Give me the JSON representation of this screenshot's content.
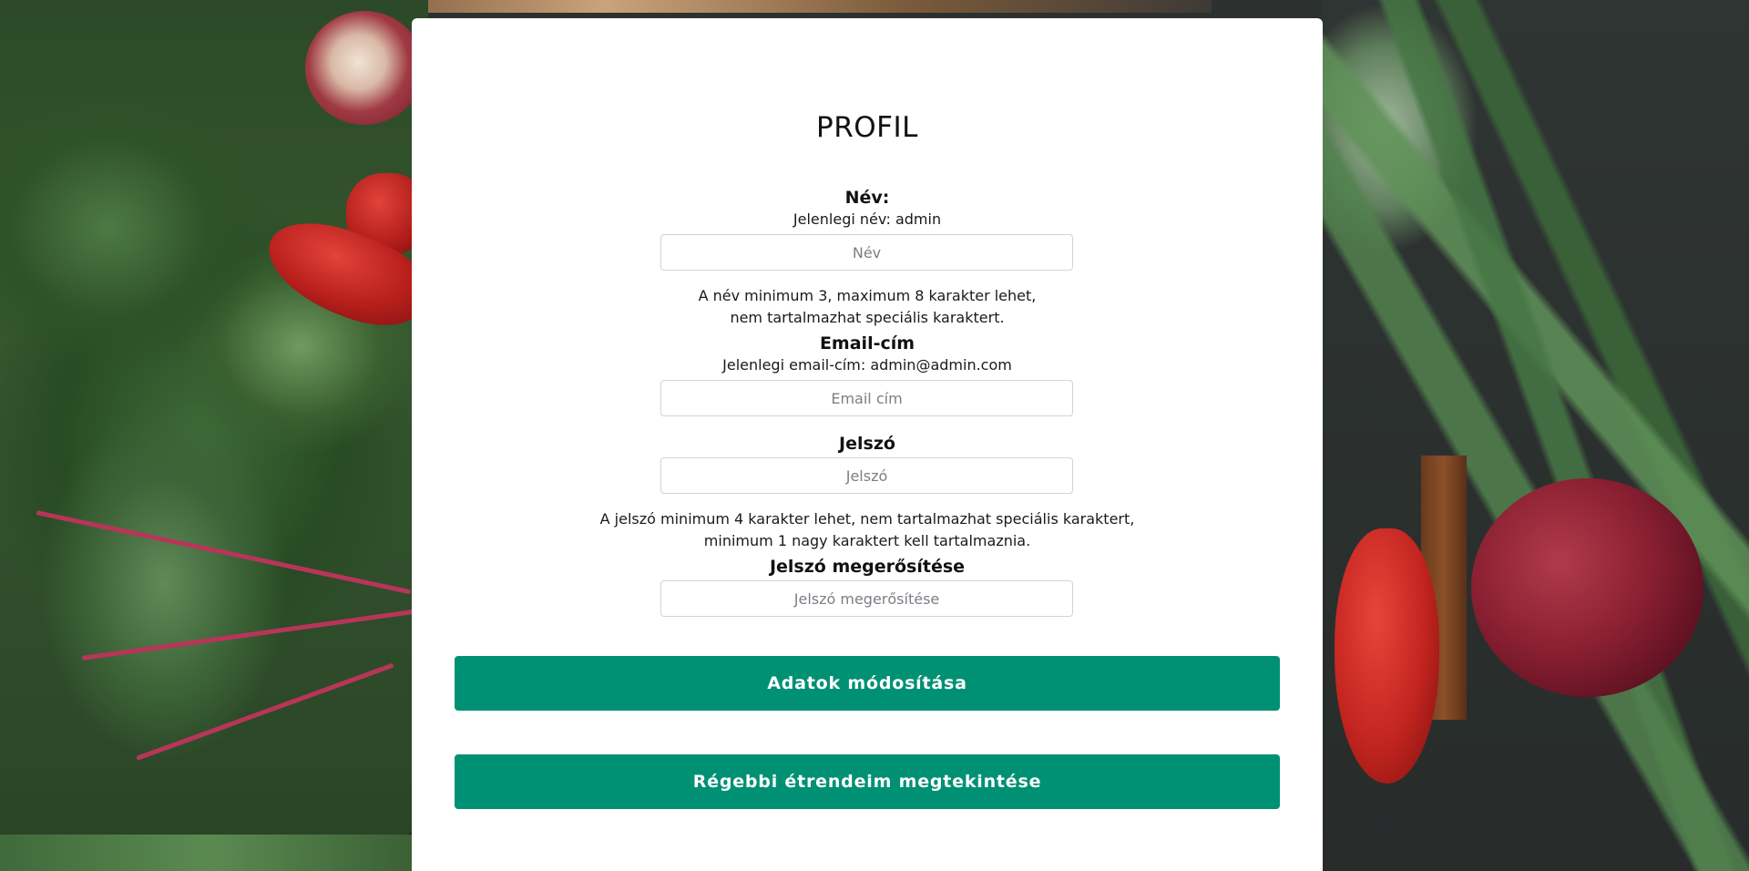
{
  "profile": {
    "title": "PROFIL",
    "name": {
      "label": "Név:",
      "current": "Jelenlegi név: admin",
      "placeholder": "Név",
      "hint_line1": "A név minimum 3, maximum 8 karakter lehet,",
      "hint_line2": "nem tartalmazhat speciális karaktert."
    },
    "email": {
      "label": "Email-cím",
      "current": "Jelenlegi email-cím: admin@admin.com",
      "placeholder": "Email cím"
    },
    "password": {
      "label": "Jelszó",
      "placeholder": "Jelszó",
      "hint_line1": "A jelszó minimum 4 karakter lehet, nem tartalmazhat speciális karaktert,",
      "hint_line2": "minimum 1 nagy karaktert kell tartalmaznia."
    },
    "password_confirm": {
      "label": "Jelszó megerősítése",
      "placeholder": "Jelszó megerősítése"
    },
    "buttons": {
      "update": "Adatok módosítása",
      "history": "Régebbi étrendeim megtekintése"
    }
  },
  "colors": {
    "primary_button": "#009174",
    "card_background": "#ffffff"
  }
}
